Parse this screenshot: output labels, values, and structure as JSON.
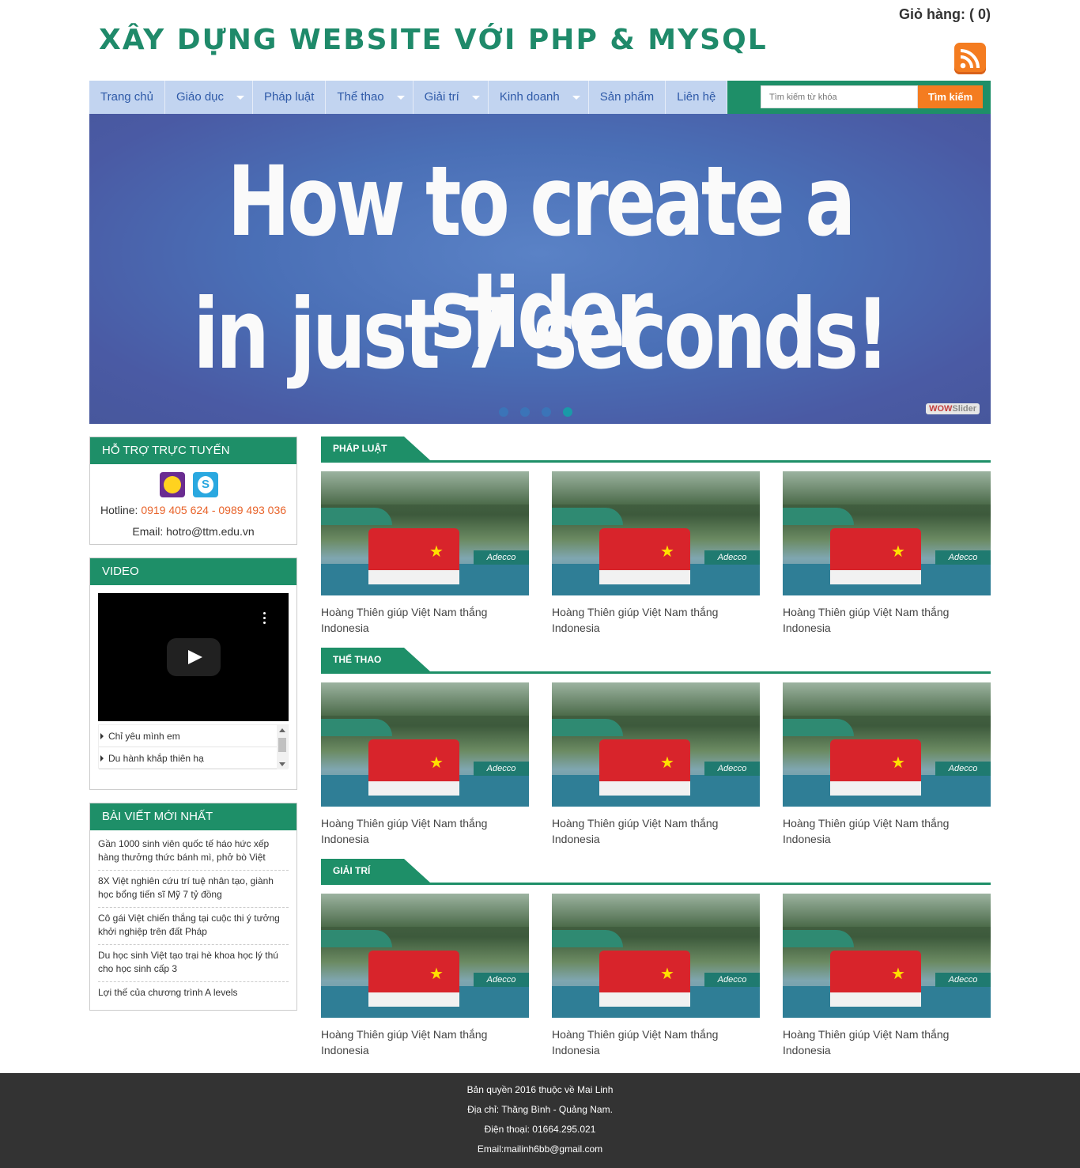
{
  "header": {
    "site_title": "XÂY DỰNG WEBSITE VỚI PHP & MYSQL",
    "cart_label": "Giỏ hàng: ( 0)",
    "rss_icon": "rss-icon"
  },
  "nav": {
    "items": [
      {
        "label": "Trang chủ",
        "dropdown": false
      },
      {
        "label": "Giáo dục",
        "dropdown": true
      },
      {
        "label": "Pháp luật",
        "dropdown": false
      },
      {
        "label": "Thể thao",
        "dropdown": true
      },
      {
        "label": "Giải trí",
        "dropdown": true
      },
      {
        "label": "Kinh doanh",
        "dropdown": true
      },
      {
        "label": "Sản phẩm",
        "dropdown": false
      },
      {
        "label": "Liên hệ",
        "dropdown": false
      }
    ],
    "search_placeholder": "Tìm kiếm từ khóa",
    "search_button": "Tìm kiếm"
  },
  "slider": {
    "line1": "How to create a slider",
    "line2": "in just 7 seconds!",
    "watermark_a": "WOW",
    "watermark_b": "Slider",
    "active_dot": 4
  },
  "sidebar": {
    "support": {
      "title": "HỖ TRỢ TRỰC TUYẾN",
      "hotline_label": "Hotline: ",
      "hotline_numbers": "0919 405 624 - 0989 493 036",
      "email": "Email: hotro@ttm.edu.vn"
    },
    "video": {
      "title": "VIDEO",
      "items": [
        "Chỉ yêu mình em",
        "Du hành khắp thiên hạ"
      ]
    },
    "latest": {
      "title": "BÀI VIẾT MỚI NHẤT",
      "items": [
        "Gần 1000 sinh viên quốc tế háo hức xếp hàng thưởng thức bánh mì, phở bò Việt",
        "8X Việt nghiên cứu trí tuệ nhân tạo, giành học bổng tiến sĩ Mỹ 7 tỷ đồng",
        "Cô gái Việt chiến thắng tại cuộc thi ý tưởng khởi nghiệp trên đất Pháp",
        "Du học sinh Việt tạo trại hè khoa học lý thú cho học sinh cấp 3",
        "Lợi thế của chương trình A levels"
      ]
    }
  },
  "sections": [
    {
      "title": "PHÁP LUẬT",
      "cards": [
        "Hoàng Thiên giúp Việt Nam thắng Indonesia",
        "Hoàng Thiên giúp Việt Nam thắng Indonesia",
        "Hoàng Thiên giúp Việt Nam thắng Indonesia"
      ]
    },
    {
      "title": "THỂ THAO",
      "cards": [
        "Hoàng Thiên giúp Việt Nam thắng Indonesia",
        "Hoàng Thiên giúp Việt Nam thắng Indonesia",
        "Hoàng Thiên giúp Việt Nam thắng Indonesia"
      ]
    },
    {
      "title": "GIẢI TRÍ",
      "cards": [
        "Hoàng Thiên giúp Việt Nam thắng Indonesia",
        "Hoàng Thiên giúp Việt Nam thắng Indonesia",
        "Hoàng Thiên giúp Việt Nam thắng Indonesia"
      ]
    }
  ],
  "card_banner_text": "Adecco",
  "footer": {
    "line1": "Bản quyền 2016 thuộc về Mai Linh",
    "line2": "Địa chỉ: Thăng Bình - Quảng Nam.",
    "line3": "Điện thoại: 01664.295.021",
    "line4": "Email:mailinh6bb@gmail.com"
  },
  "colors": {
    "accent_green": "#1e8f68",
    "accent_orange": "#f47c20",
    "nav_blue": "#c2d4f0",
    "footer_bg": "#333333"
  }
}
